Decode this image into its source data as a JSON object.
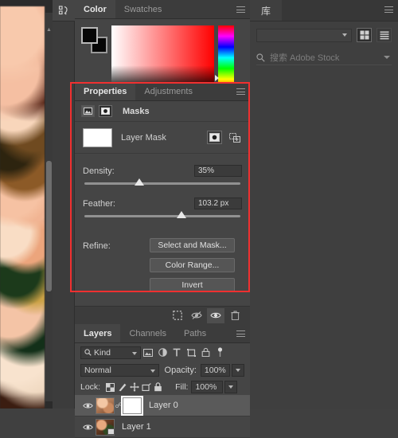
{
  "app": "Adobe Photoshop",
  "canvas": {
    "name": "document-canvas",
    "image_description": "peach and cream roses photograph"
  },
  "color_panel": {
    "tabs": [
      {
        "label": "Color",
        "active": true
      },
      {
        "label": "Swatches",
        "active": false
      }
    ],
    "foreground_color": "#000000",
    "background_color": "#000000",
    "field_hue": "#ff0000"
  },
  "properties_panel": {
    "tabs": [
      {
        "label": "Properties",
        "active": true
      },
      {
        "label": "Adjustments",
        "active": false
      }
    ],
    "header_label": "Masks",
    "mask_type_buttons": [
      {
        "name": "pixel-mask-icon",
        "active": false
      },
      {
        "name": "vector-mask-icon",
        "active": true
      }
    ],
    "layer_mask": {
      "label": "Layer Mask",
      "thumb_color": "#ffffff"
    },
    "density": {
      "label": "Density:",
      "value": "35%",
      "percent": 35
    },
    "feather": {
      "label": "Feather:",
      "value": "103.2 px",
      "percent": 62
    },
    "refine": {
      "label": "Refine:",
      "buttons": [
        "Select and Mask...",
        "Color Range...",
        "Invert"
      ]
    },
    "footer_icons": [
      "load-selection-icon",
      "apply-mask-icon",
      "toggle-mask-visibility-icon",
      "delete-mask-icon"
    ]
  },
  "layers_panel": {
    "tabs": [
      {
        "label": "Layers",
        "active": true
      },
      {
        "label": "Channels",
        "active": false
      },
      {
        "label": "Paths",
        "active": false
      }
    ],
    "filter": {
      "kind_label": "Kind",
      "icons": [
        "filter-pixel-icon",
        "filter-adjustment-icon",
        "filter-type-icon",
        "filter-shape-icon",
        "filter-smart-object-icon",
        "filter-toggle-icon"
      ]
    },
    "blend_mode": "Normal",
    "opacity_label": "Opacity:",
    "opacity_value": "100%",
    "lock_label": "Lock:",
    "lock_icons": [
      "lock-transparent-pixels-icon",
      "lock-image-pixels-icon",
      "lock-position-icon",
      "lock-artboard-icon",
      "lock-all-icon"
    ],
    "fill_label": "Fill:",
    "fill_value": "100%",
    "layers": [
      {
        "name": "Layer 0",
        "visible": true,
        "selected": true,
        "has_mask": true
      },
      {
        "name": "Layer 1",
        "visible": true,
        "selected": false,
        "has_mask": false
      }
    ]
  },
  "libraries_panel": {
    "tab_label": "库",
    "search_placeholder": "搜索 Adobe Stock",
    "view_buttons": [
      "grid-view-icon",
      "list-view-icon"
    ]
  },
  "annotation": {
    "name": "red-highlight-rectangle",
    "color": "#f03030",
    "target": "Properties panel masks section"
  }
}
